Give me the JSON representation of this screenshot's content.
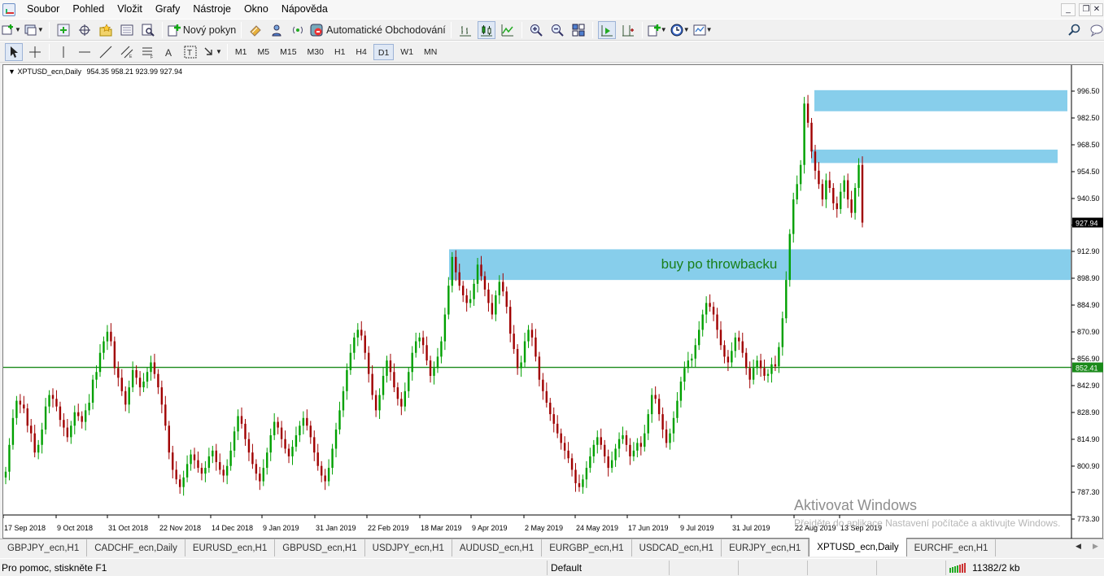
{
  "menu": [
    "Soubor",
    "Pohled",
    "Vložit",
    "Grafy",
    "Nástroje",
    "Okno",
    "Nápověda"
  ],
  "toolbar": {
    "new_order_label": "Nový pokyn",
    "auto_trading_label": "Automatické Obchodování"
  },
  "timeframes": [
    "M1",
    "M5",
    "M15",
    "M30",
    "H1",
    "H4",
    "D1",
    "W1",
    "MN"
  ],
  "active_timeframe": "D1",
  "chart": {
    "symbol_header": "XPTUSD_ecn,Daily",
    "ohlc": "954.35 958.21 923.99 927.94",
    "annotation_text": "buy po throwbacku",
    "annotation_color": "#1a7f1a",
    "zone_color": "#87ceeb",
    "horizontal_line_color": "#1a8a1a",
    "bull_color": "#00a000",
    "bear_color": "#a00000"
  },
  "chart_data": {
    "type": "candlestick",
    "y_axis_ticks": [
      "996.50",
      "982.50",
      "968.50",
      "954.50",
      "940.50",
      "926.60",
      "912.90",
      "898.90",
      "884.90",
      "870.90",
      "856.90",
      "842.90",
      "828.90",
      "814.90",
      "800.90",
      "787.30",
      "773.30"
    ],
    "ylim": [
      773.3,
      1002
    ],
    "x_axis_labels": [
      "17 Sep 2018",
      "9 Oct 2018",
      "31 Oct 2018",
      "22 Nov 2018",
      "14 Dec 2018",
      "9 Jan 2019",
      "31 Jan 2019",
      "22 Feb 2019",
      "18 Mar 2019",
      "9 Apr 2019",
      "2 May 2019",
      "24 May 2019",
      "17 Jun 2019",
      "9 Jul 2019",
      "31 Jul 2019",
      "22 Aug 2019",
      "13 Sep 2019"
    ],
    "current_price": "927.94",
    "horizontal_line_price": "852.41",
    "closes": [
      798,
      812,
      826,
      835,
      833,
      831,
      822,
      818,
      808,
      812,
      820,
      832,
      838,
      836,
      832,
      825,
      821,
      816,
      822,
      829,
      827,
      824,
      830,
      834,
      846,
      850,
      860,
      866,
      871,
      866,
      852,
      847,
      840,
      833,
      842,
      851,
      847,
      842,
      845,
      850,
      855,
      849,
      842,
      833,
      822,
      808,
      799,
      794,
      790,
      795,
      802,
      807,
      804,
      800,
      797,
      800,
      806,
      809,
      803,
      799,
      796,
      801,
      809,
      819,
      827,
      823,
      815,
      808,
      802,
      797,
      793,
      800,
      808,
      817,
      824,
      821,
      815,
      810,
      806,
      811,
      817,
      822,
      826,
      822,
      816,
      808,
      801,
      796,
      793,
      800,
      810,
      820,
      830,
      840,
      851,
      860,
      868,
      872,
      869,
      860,
      849,
      838,
      830,
      838,
      848,
      856,
      850,
      842,
      836,
      832,
      840,
      850,
      860,
      866,
      868,
      864,
      856,
      848,
      852,
      858,
      866,
      880,
      895,
      910,
      902,
      895,
      890,
      886,
      888,
      896,
      906,
      900,
      893,
      886,
      880,
      890,
      897,
      892,
      884,
      870,
      862,
      852,
      855,
      866,
      872,
      868,
      858,
      846,
      840,
      834,
      828,
      823,
      818,
      813,
      809,
      805,
      799,
      792,
      790,
      794,
      800,
      806,
      812,
      816,
      812,
      806,
      800,
      804,
      810,
      815,
      817,
      812,
      806,
      809,
      813,
      811,
      818,
      828,
      838,
      836,
      828,
      820,
      813,
      818,
      826,
      835,
      845,
      852,
      856,
      857,
      864,
      872,
      880,
      886,
      884,
      880,
      872,
      864,
      858,
      855,
      861,
      868,
      866,
      860,
      852,
      846,
      852,
      856,
      852,
      848,
      849,
      854,
      853,
      863,
      878,
      898,
      922,
      940,
      948,
      958,
      990,
      980,
      965,
      955,
      948,
      940,
      950,
      946,
      938,
      935,
      944,
      950,
      940,
      933,
      946,
      958,
      927.94
    ],
    "zones": [
      {
        "label": "upper resistance zone",
        "price_top": 997,
        "price_bottom": 986
      },
      {
        "label": "resistance zone",
        "price_top": 966,
        "price_bottom": 959
      },
      {
        "label": "buy zone",
        "price_top": 914,
        "price_bottom": 898
      }
    ]
  },
  "tabs": [
    "GBPJPY_ecn,H1",
    "CADCHF_ecn,Daily",
    "EURUSD_ecn,H1",
    "GBPUSD_ecn,H1",
    "USDJPY_ecn,H1",
    "AUDUSD_ecn,H1",
    "EURGBP_ecn,H1",
    "USDCAD_ecn,H1",
    "EURJPY_ecn,H1",
    "XPTUSD_ecn,Daily",
    "EURCHF_ecn,H1"
  ],
  "active_tab": "XPTUSD_ecn,Daily",
  "status": {
    "help": "Pro pomoc, stiskněte F1",
    "profile": "Default",
    "traffic": "11382/2 kb"
  },
  "watermark": {
    "title": "Aktivovat Windows",
    "body": "Přejděte do aplikace Nastavení počítače a aktivujte Windows."
  }
}
